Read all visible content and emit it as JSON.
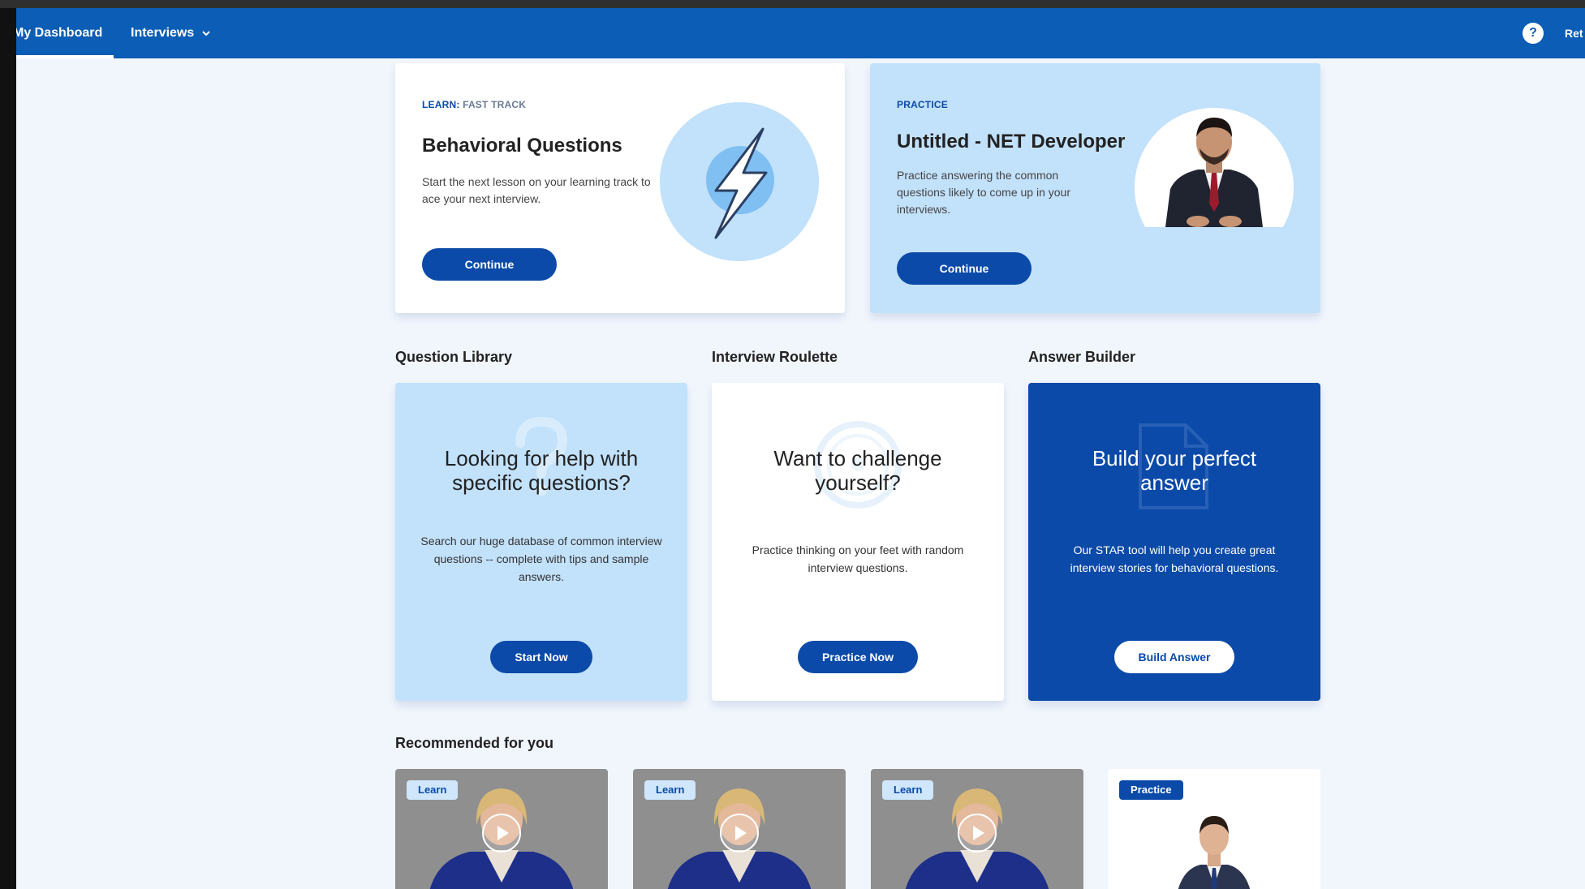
{
  "nav": {
    "dashboard_label": "My Dashboard",
    "interviews_label": "Interviews",
    "help_glyph": "?",
    "right_label": "Ret"
  },
  "learn_card": {
    "eyebrow_primary": "LEARN:",
    "eyebrow_secondary": "FAST TRACK",
    "title": "Behavioral Questions",
    "description": "Start the next lesson on your learning track to ace your next interview.",
    "button_label": "Continue",
    "icon": "lightning-icon"
  },
  "practice_card": {
    "eyebrow": "PRACTICE",
    "title": "Untitled - NET Developer",
    "description": "Practice answering the common questions likely to come up in your interviews.",
    "button_label": "Continue",
    "image": "interviewer-avatar"
  },
  "sections": {
    "question_library": "Question Library",
    "interview_roulette": "Interview Roulette",
    "answer_builder": "Answer Builder",
    "recommended": "Recommended for you"
  },
  "question_library": {
    "heading": "Looking for help with specific questions?",
    "body": "Search our huge database of common interview questions -- complete with tips and sample answers.",
    "button_label": "Start Now",
    "icon": "question-mark-icon"
  },
  "interview_roulette": {
    "heading": "Want to challenge yourself?",
    "body": "Practice thinking on your feet with random interview questions.",
    "button_label": "Practice Now",
    "icon": "roulette-wheel-icon"
  },
  "answer_builder": {
    "heading": "Build your perfect answer",
    "body": "Our STAR tool will help you create great interview stories for behavioral questions.",
    "button_label": "Build Answer",
    "icon": "document-icon"
  },
  "recommended": [
    {
      "badge": "Learn",
      "type": "learn",
      "icon": "play-icon"
    },
    {
      "badge": "Learn",
      "type": "learn",
      "icon": "play-icon"
    },
    {
      "badge": "Learn",
      "type": "learn",
      "icon": "play-icon"
    },
    {
      "badge": "Practice",
      "type": "practice",
      "icon": "interviewer-avatar"
    }
  ],
  "colors": {
    "brand_blue": "#0b5db5",
    "button_blue": "#0b4aa8",
    "light_blue": "#c2e1fb",
    "page_bg": "#f1f6fd"
  }
}
